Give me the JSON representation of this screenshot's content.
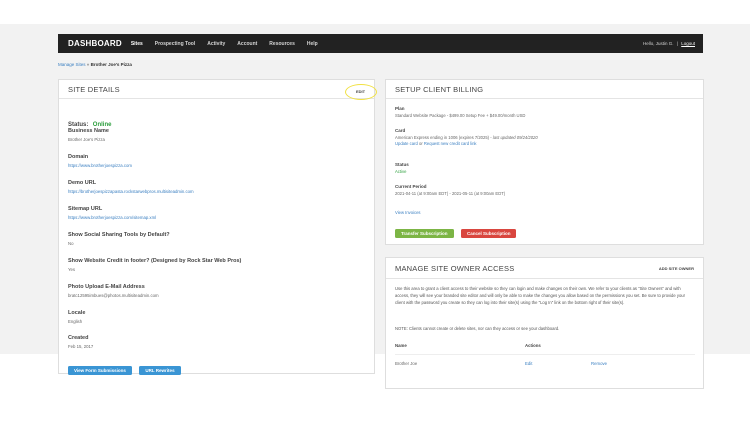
{
  "nav": {
    "brand": "DASHBOARD",
    "items": [
      {
        "label": "Sites",
        "active": true
      },
      {
        "label": "Prospecting Tool",
        "active": false
      },
      {
        "label": "Activity",
        "active": false
      },
      {
        "label": "Account",
        "active": false
      },
      {
        "label": "Resources",
        "active": false
      },
      {
        "label": "Help",
        "active": false
      }
    ],
    "greeting": "Hello, Justin G.",
    "separator": "|",
    "logout": "Logout"
  },
  "breadcrumb": {
    "parent": "Manage Sites",
    "separator": "»",
    "current": "Brother Joe's Pizza"
  },
  "site_details": {
    "title": "SITE DETAILS",
    "edit_label": "EDIT",
    "status_label": "Status:",
    "status_value": "Online",
    "fields": [
      {
        "label": "Business Name",
        "value": "Brother Joe's Pizza"
      },
      {
        "label": "Domain",
        "value": "https://www.brotherjoespizza.com"
      },
      {
        "label": "Demo URL",
        "value": "https://brotherjoespizzapasta.rockstarwebpros.multisiteadmin.com"
      },
      {
        "label": "Sitemap URL",
        "value": "https://www.brotherjoespizza.com/sitemap.xml"
      },
      {
        "label": "Show Social Sharing Tools by Default?",
        "value": "No"
      },
      {
        "label": "Show Website Credit in footer? (Designed by Rock Star Web Pros)",
        "value": "Yes"
      },
      {
        "label": "Photo Upload E-Mail Address",
        "value": "bratc12595imbues@photos.multisiteadmin.com"
      },
      {
        "label": "Locale",
        "value": "English"
      },
      {
        "label": "Created",
        "value": "Feb 15, 2017"
      }
    ],
    "buttons": {
      "form_submissions": "View Form Submissions",
      "url_rewrites": "URL Rewrites"
    }
  },
  "billing": {
    "title": "SETUP CLIENT BILLING",
    "plan_label": "Plan",
    "plan_value": "Standard Website Package - $499.00 Setup Fee + $49.00/month USD",
    "card_label": "Card",
    "card_value": "American Express ending in 1006 (expires 7/2025) -",
    "card_updated": "last updated 09/24/2020",
    "card_update_link": "Update card",
    "card_or": "or",
    "card_request_link": "Request new credit card link",
    "status_label": "Status",
    "status_value": "Active",
    "period_label": "Current Period",
    "period_value": "2021-04-11 (at 9:00am EDT) - 2021-05-11 (at 9:00am EDT)",
    "invoices_link": "View Invoices",
    "transfer_button": "Transfer Subscription",
    "cancel_button": "Cancel Subscription"
  },
  "owner_access": {
    "title": "MANAGE SITE OWNER ACCESS",
    "add_label": "ADD SITE OWNER",
    "description": "Use this area to grant a client access to their website so they can login and make changes on their own. We refer to your clients as \"Site Owners\" and with access, they will see your branded site editor and will only be able to make the changes you allow based on the permissions you set. Be sure to provide your client with the password you create so they can log into their site(s) using the \"Log In\" link on the bottom right of their site(s).",
    "note": "NOTE: Clients cannot create or delete sites, nor can they access or see your dashboard.",
    "columns": [
      "Name",
      "Actions"
    ],
    "rows": [
      {
        "name": "Brother Joe",
        "edit": "Edit",
        "remove": "Remove"
      }
    ]
  },
  "colors": {
    "nav_bg": "#222222",
    "link": "#3a7fc1",
    "online": "#2b9e3c",
    "edit_highlight": "#f1e143"
  }
}
